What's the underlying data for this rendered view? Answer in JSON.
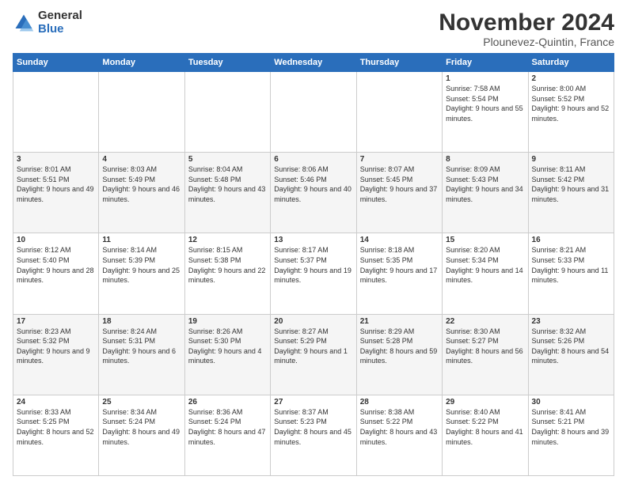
{
  "logo": {
    "general": "General",
    "blue": "Blue"
  },
  "title": "November 2024",
  "location": "Plounevez-Quintin, France",
  "headers": [
    "Sunday",
    "Monday",
    "Tuesday",
    "Wednesday",
    "Thursday",
    "Friday",
    "Saturday"
  ],
  "weeks": [
    [
      {
        "day": "",
        "info": ""
      },
      {
        "day": "",
        "info": ""
      },
      {
        "day": "",
        "info": ""
      },
      {
        "day": "",
        "info": ""
      },
      {
        "day": "",
        "info": ""
      },
      {
        "day": "1",
        "info": "Sunrise: 7:58 AM\nSunset: 5:54 PM\nDaylight: 9 hours and 55 minutes."
      },
      {
        "day": "2",
        "info": "Sunrise: 8:00 AM\nSunset: 5:52 PM\nDaylight: 9 hours and 52 minutes."
      }
    ],
    [
      {
        "day": "3",
        "info": "Sunrise: 8:01 AM\nSunset: 5:51 PM\nDaylight: 9 hours and 49 minutes."
      },
      {
        "day": "4",
        "info": "Sunrise: 8:03 AM\nSunset: 5:49 PM\nDaylight: 9 hours and 46 minutes."
      },
      {
        "day": "5",
        "info": "Sunrise: 8:04 AM\nSunset: 5:48 PM\nDaylight: 9 hours and 43 minutes."
      },
      {
        "day": "6",
        "info": "Sunrise: 8:06 AM\nSunset: 5:46 PM\nDaylight: 9 hours and 40 minutes."
      },
      {
        "day": "7",
        "info": "Sunrise: 8:07 AM\nSunset: 5:45 PM\nDaylight: 9 hours and 37 minutes."
      },
      {
        "day": "8",
        "info": "Sunrise: 8:09 AM\nSunset: 5:43 PM\nDaylight: 9 hours and 34 minutes."
      },
      {
        "day": "9",
        "info": "Sunrise: 8:11 AM\nSunset: 5:42 PM\nDaylight: 9 hours and 31 minutes."
      }
    ],
    [
      {
        "day": "10",
        "info": "Sunrise: 8:12 AM\nSunset: 5:40 PM\nDaylight: 9 hours and 28 minutes."
      },
      {
        "day": "11",
        "info": "Sunrise: 8:14 AM\nSunset: 5:39 PM\nDaylight: 9 hours and 25 minutes."
      },
      {
        "day": "12",
        "info": "Sunrise: 8:15 AM\nSunset: 5:38 PM\nDaylight: 9 hours and 22 minutes."
      },
      {
        "day": "13",
        "info": "Sunrise: 8:17 AM\nSunset: 5:37 PM\nDaylight: 9 hours and 19 minutes."
      },
      {
        "day": "14",
        "info": "Sunrise: 8:18 AM\nSunset: 5:35 PM\nDaylight: 9 hours and 17 minutes."
      },
      {
        "day": "15",
        "info": "Sunrise: 8:20 AM\nSunset: 5:34 PM\nDaylight: 9 hours and 14 minutes."
      },
      {
        "day": "16",
        "info": "Sunrise: 8:21 AM\nSunset: 5:33 PM\nDaylight: 9 hours and 11 minutes."
      }
    ],
    [
      {
        "day": "17",
        "info": "Sunrise: 8:23 AM\nSunset: 5:32 PM\nDaylight: 9 hours and 9 minutes."
      },
      {
        "day": "18",
        "info": "Sunrise: 8:24 AM\nSunset: 5:31 PM\nDaylight: 9 hours and 6 minutes."
      },
      {
        "day": "19",
        "info": "Sunrise: 8:26 AM\nSunset: 5:30 PM\nDaylight: 9 hours and 4 minutes."
      },
      {
        "day": "20",
        "info": "Sunrise: 8:27 AM\nSunset: 5:29 PM\nDaylight: 9 hours and 1 minute."
      },
      {
        "day": "21",
        "info": "Sunrise: 8:29 AM\nSunset: 5:28 PM\nDaylight: 8 hours and 59 minutes."
      },
      {
        "day": "22",
        "info": "Sunrise: 8:30 AM\nSunset: 5:27 PM\nDaylight: 8 hours and 56 minutes."
      },
      {
        "day": "23",
        "info": "Sunrise: 8:32 AM\nSunset: 5:26 PM\nDaylight: 8 hours and 54 minutes."
      }
    ],
    [
      {
        "day": "24",
        "info": "Sunrise: 8:33 AM\nSunset: 5:25 PM\nDaylight: 8 hours and 52 minutes."
      },
      {
        "day": "25",
        "info": "Sunrise: 8:34 AM\nSunset: 5:24 PM\nDaylight: 8 hours and 49 minutes."
      },
      {
        "day": "26",
        "info": "Sunrise: 8:36 AM\nSunset: 5:24 PM\nDaylight: 8 hours and 47 minutes."
      },
      {
        "day": "27",
        "info": "Sunrise: 8:37 AM\nSunset: 5:23 PM\nDaylight: 8 hours and 45 minutes."
      },
      {
        "day": "28",
        "info": "Sunrise: 8:38 AM\nSunset: 5:22 PM\nDaylight: 8 hours and 43 minutes."
      },
      {
        "day": "29",
        "info": "Sunrise: 8:40 AM\nSunset: 5:22 PM\nDaylight: 8 hours and 41 minutes."
      },
      {
        "day": "30",
        "info": "Sunrise: 8:41 AM\nSunset: 5:21 PM\nDaylight: 8 hours and 39 minutes."
      }
    ]
  ]
}
